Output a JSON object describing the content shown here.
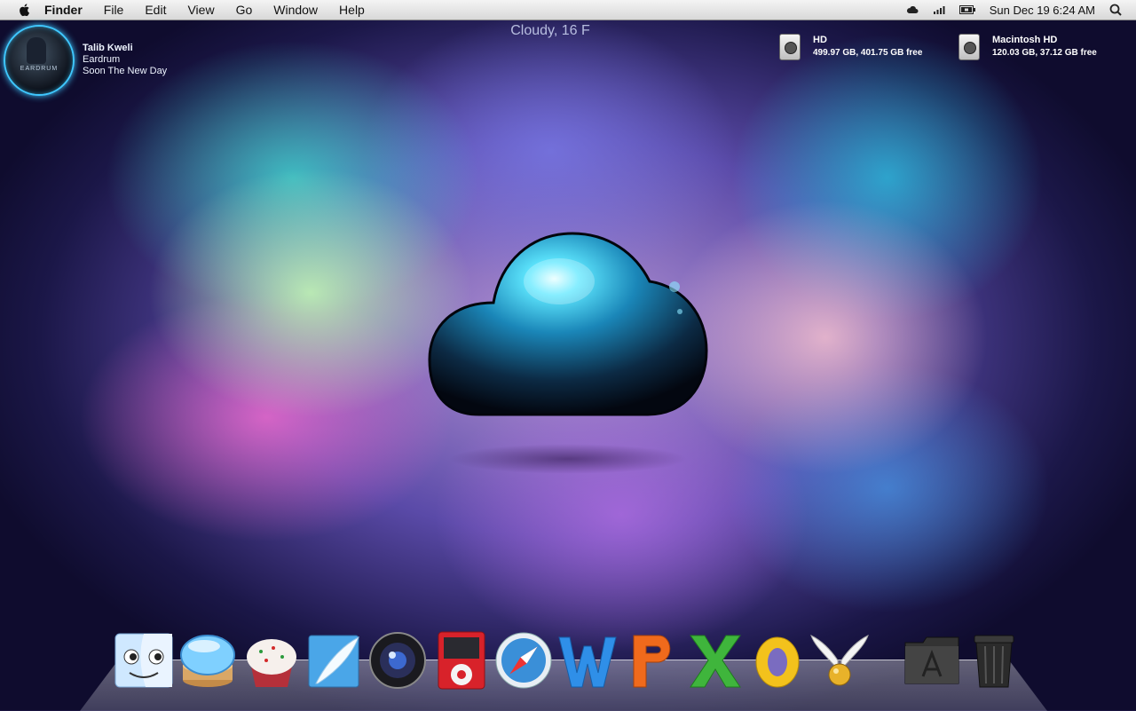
{
  "menubar": {
    "app_name": "Finder",
    "menus": [
      "File",
      "Edit",
      "View",
      "Go",
      "Window"
    ],
    "help": "Help",
    "clock": "Sun Dec 19  6:24 AM",
    "status_icons": [
      "cloud-icon",
      "signal-icon",
      "battery-icon",
      "spotlight-icon"
    ]
  },
  "weather": {
    "text": "Cloudy, 16 F"
  },
  "now_playing": {
    "artist": "Talib Kweli",
    "album": "Eardrum",
    "track": "Soon The New Day",
    "art_label": "EARDRUM"
  },
  "drives": [
    {
      "name": "HD",
      "info": "499.97 GB, 401.75 GB free"
    },
    {
      "name": "Macintosh HD",
      "info": "120.03 GB, 37.12 GB free"
    }
  ],
  "dock": {
    "items": [
      "finder-icon",
      "ichat-icon",
      "cupcake-icon",
      "feather-icon",
      "camera-lens-icon",
      "ipod-icon",
      "safari-icon",
      "word-icon",
      "powerpoint-icon",
      "excel-icon",
      "outlook-icon",
      "snitch-icon",
      "applications-folder-icon",
      "trash-icon"
    ]
  },
  "colors": {
    "accent_glow": "#3fc8ff",
    "menubar": "#e6e6e6"
  }
}
